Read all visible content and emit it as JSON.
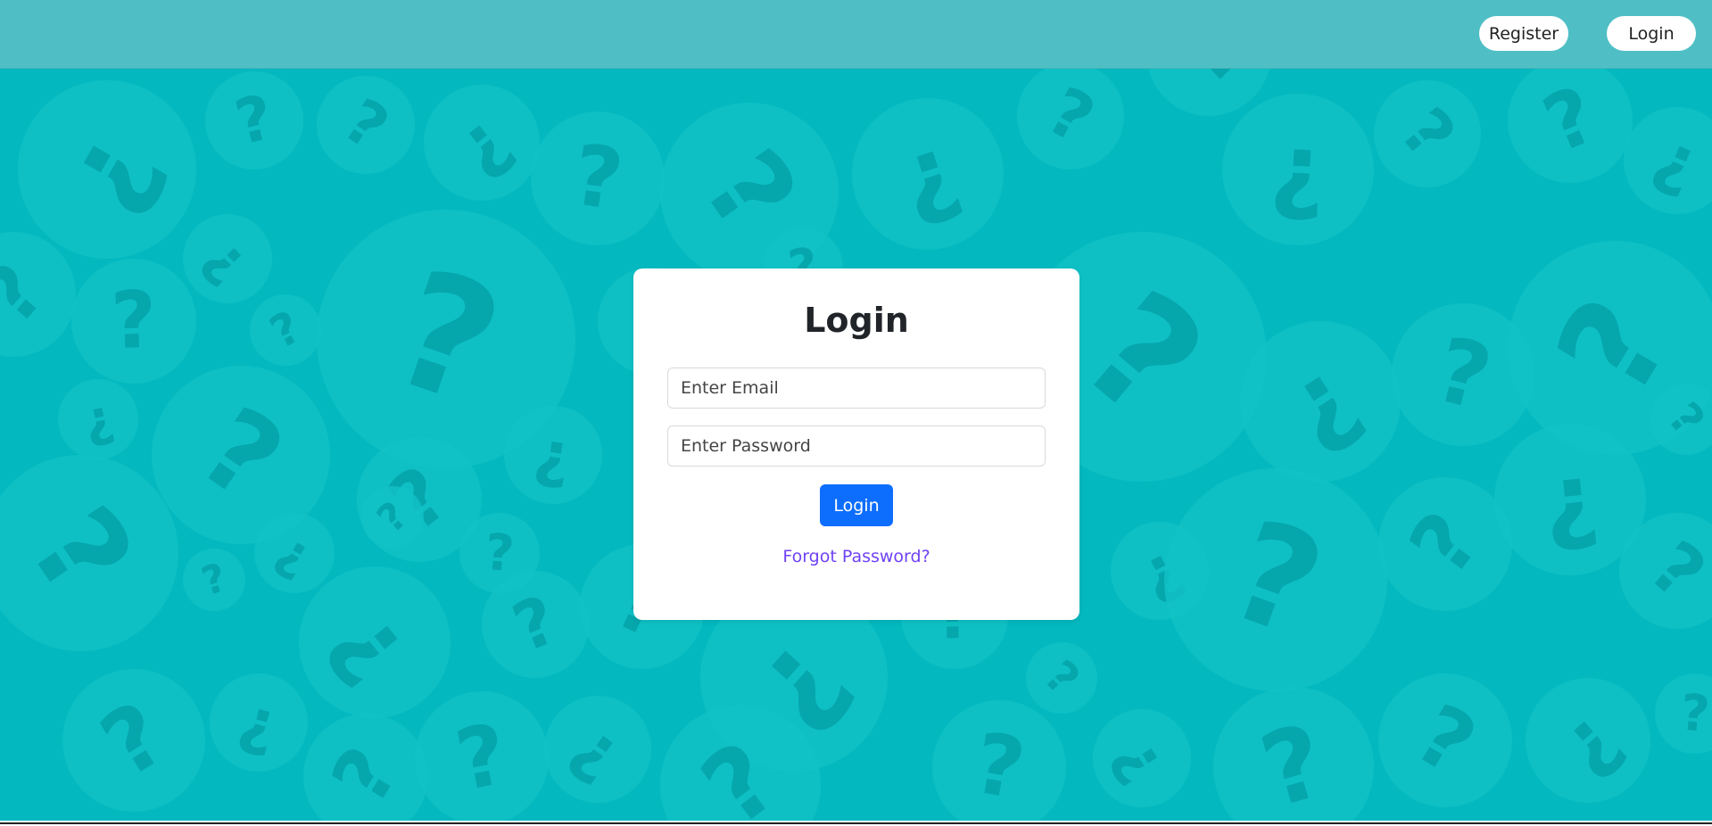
{
  "header": {
    "register_label": "Register",
    "login_label": "Login"
  },
  "login_card": {
    "title": "Login",
    "email_placeholder": "Enter Email",
    "password_placeholder": "Enter Password",
    "submit_label": "Login",
    "forgot_password_label": "Forgot Password?"
  },
  "colors": {
    "background": "#03b8bf",
    "topbar": "#4fbfc5",
    "primary_button": "#0d6efd",
    "link": "#6f42f5"
  },
  "background_pattern_icon": "question-mark-icon"
}
